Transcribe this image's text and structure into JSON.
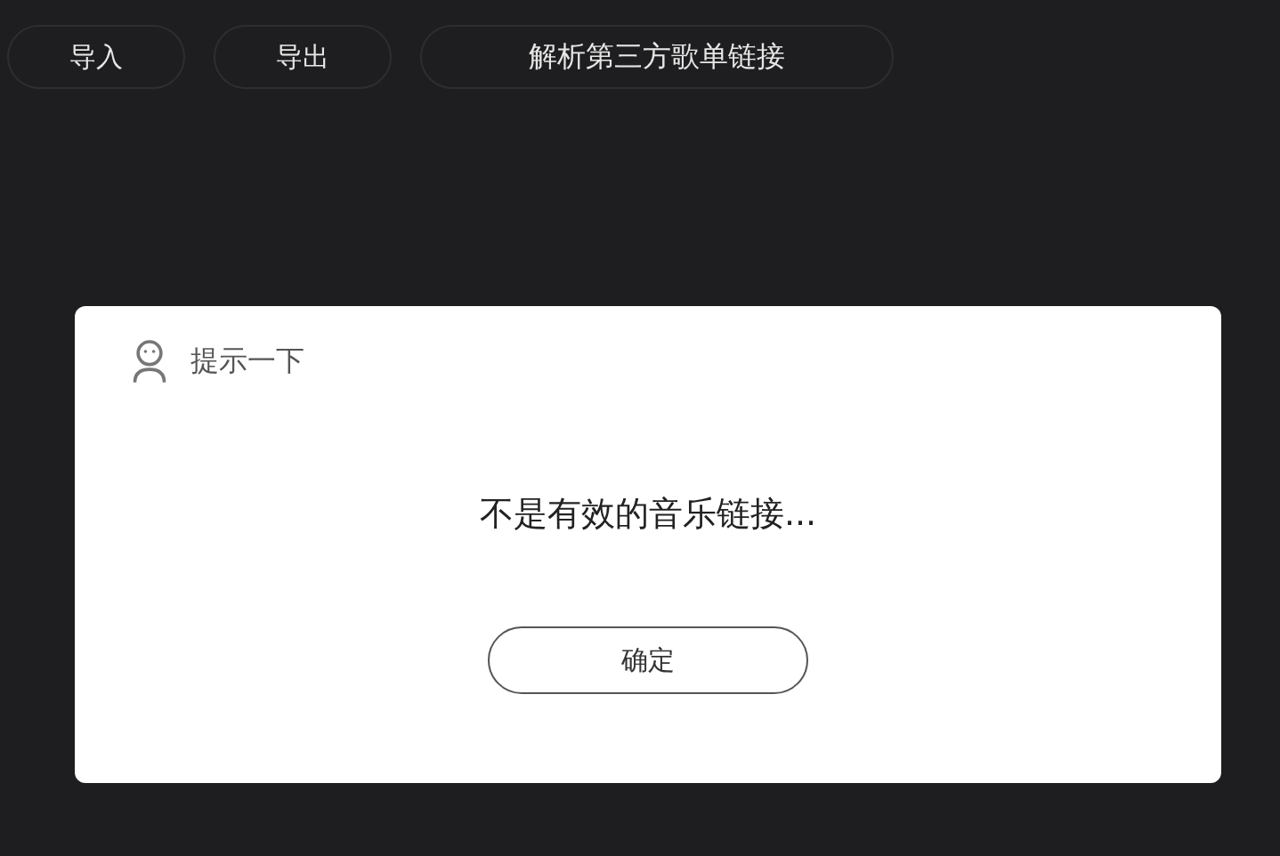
{
  "toolbar": [
    {
      "label": "导入"
    },
    {
      "label": "导出"
    },
    {
      "label": "解析第三方歌单链接"
    }
  ],
  "dialog": {
    "title": "提示一下",
    "message": "不是有效的音乐链接...",
    "button": "确定"
  }
}
